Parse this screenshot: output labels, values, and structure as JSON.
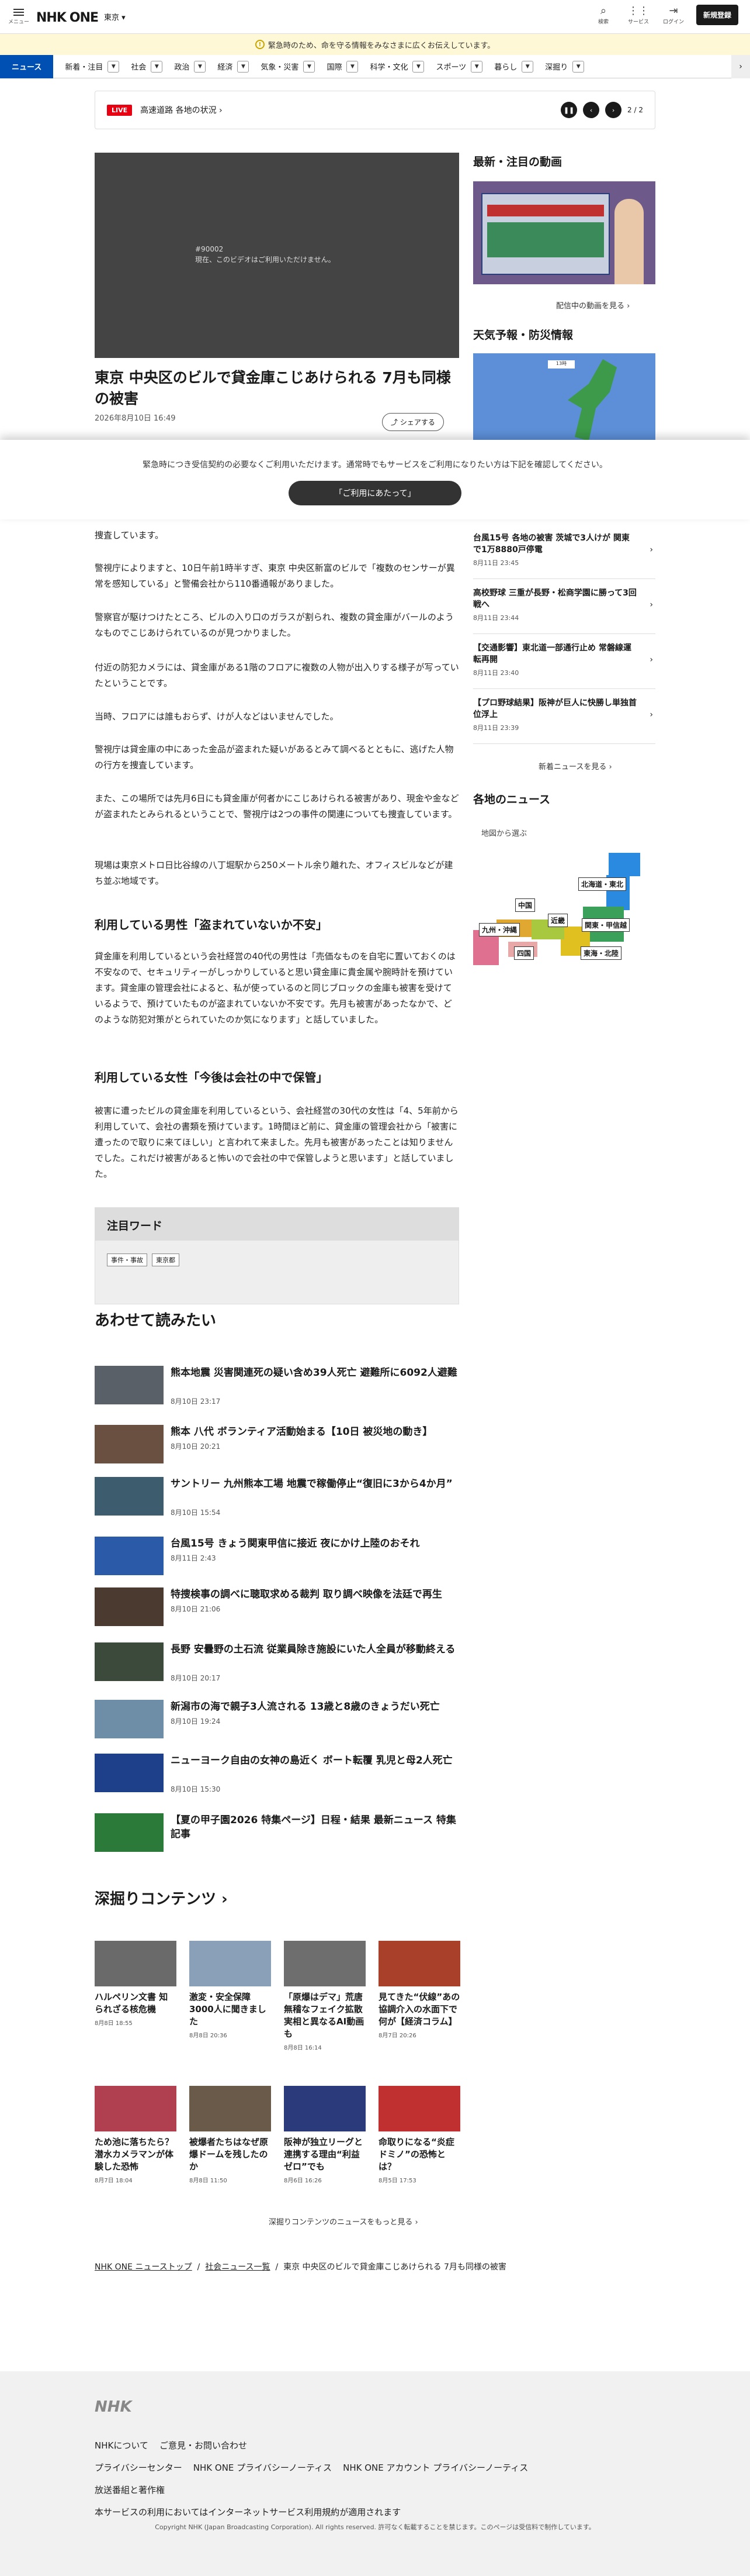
{
  "header": {
    "menu_label": "メニュー",
    "logo_text": "NHK",
    "logo_one": "ONE",
    "area": "東京 ▾",
    "icons": [
      {
        "name": "search",
        "label": "検索",
        "glyph": "⌕"
      },
      {
        "name": "service",
        "label": "サービス",
        "glyph": "⋮⋮"
      },
      {
        "name": "login",
        "label": "ログイン",
        "glyph": "⇥"
      }
    ],
    "register": "新規登録"
  },
  "alert": {
    "icon": "!",
    "text": "緊急時のため、命を守る情報をみなさまに広くお伝えしています。"
  },
  "nav": {
    "active": "ニュース",
    "items": [
      "新着・注目",
      "社会",
      "政治",
      "経済",
      "気象・災害",
      "国際",
      "科学・文化",
      "スポーツ",
      "暮らし",
      "深掘り"
    ]
  },
  "ticker": {
    "live": "LIVE",
    "text": "高速道路 各地の状況 ›",
    "pause": "❚❚",
    "prev": "‹",
    "next": "›",
    "page": "2 / 2"
  },
  "video": {
    "code": "#90002",
    "msg": "現在、このビデオはご利用いただけません。"
  },
  "article": {
    "title": "東京 中央区のビルで貸金庫こじあけられる 7月も同様の被害",
    "date": "2026年8月10日 16:49",
    "share": "シェアする",
    "p1": "捜査しています。",
    "p2": "警視庁によりますと、10日午前1時半すぎ、東京 中央区新富のビルで「複数のセンサーが異常を感知している」と警備会社から110番通報がありました。",
    "p3": "警察官が駆けつけたところ、ビルの入り口のガラスが割られ、複数の貸金庫がバールのようなものでこじあけられているのが見つかりました。",
    "p4": "付近の防犯カメラには、貸金庫がある1階のフロアに複数の人物が出入りする様子が写っていたということです。",
    "p5": "当時、フロアには誰もおらず、けが人などはいませんでした。",
    "p6": "警視庁は貸金庫の中にあった金品が盗まれた疑いがあるとみて調べるとともに、逃げた人物の行方を捜査しています。",
    "p7": "また、この場所では先月6日にも貸金庫が何者かにこじあけられる被害があり、現金や金などが盗まれたとみられるということで、警視庁は2つの事件の関連についても捜査しています。",
    "p8": "現場は東京メトロ日比谷線の八丁堀駅から250メートル余り離れた、オフィスビルなどが建ち並ぶ地域です。",
    "h1": "利用している男性「盗まれていないか不安」",
    "p9": "貸金庫を利用しているという会社経営の40代の男性は「売価なものを自宅に置いておくのは不安なので、セキュリティーがしっかりしていると思い貸金庫に貴金属や腕時計を預けています。貸金庫の管理会社によると、私が使っているのと同じブロックの金庫も被害を受けているようで、預けていたものが盗まれていないか不安です。先月も被害があったなかで、どのような防犯対策がとられていたのか気になります」と話していました。",
    "h2": "利用している女性「今後は会社の中で保管」",
    "p10": "被害に遭ったビルの貸金庫を利用しているという、会社経営の30代の女性は「4、5年前から利用していて、会社の書類を預けています。1時間ほど前に、貸金庫の管理会社から「被害に遭ったので取りに来てほしい」と言われて来ました。先月も被害があったことは知りませんでした。これだけ被害があると怖いので会社の中で保管しようと思います」と話していました。"
  },
  "overlay": {
    "text": "緊急時につき受信契約の必要なくご利用いただけます。通常時でもサービスをご利用になりたい方は下記を確認してください。",
    "button": "「ご利用にあたって」"
  },
  "watch": {
    "title": "注目ワード",
    "tags": [
      "事件・事故",
      "東京都"
    ]
  },
  "side": {
    "video_title": "最新・注目の動画",
    "video_more": "配信中の動画を見る ›",
    "weather_title": "天気予報・防災情報",
    "news": [
      {
        "t": "台風15号 各地の被害 茨城で3人けが 関東で1万8880戸停電",
        "d": "8月11日 23:45"
      },
      {
        "t": "高校野球 三重が長野・松商学園に勝って3回戦へ",
        "d": "8月11日 23:44"
      },
      {
        "t": "【交通影響】東北道一部通行止め 常磐線運転再開",
        "d": "8月11日 23:40"
      },
      {
        "t": "【プロ野球結果】阪神が巨人に快勝し単独首位浮上",
        "d": "8月11日 23:39"
      }
    ],
    "news_more": "新着ニュースを見る ›",
    "region_title": "各地のニュース",
    "region_sub": "地図から選ぶ",
    "regions": [
      "北海道・東北",
      "中国",
      "近畿",
      "関東・甲信越",
      "九州・沖縄",
      "四国",
      "東海・北陸"
    ]
  },
  "related": {
    "title": "あわせて読みたい",
    "items": [
      {
        "t": "熊本地震 災害関連死の疑い含め39人死亡 避難所に6092人避難",
        "d": "8月10日 23:17",
        "c": "#5a6068"
      },
      {
        "t": "熊本 八代 ボランティア活動始まる【10日 被災地の動き】",
        "d": "8月10日 20:21",
        "c": "#6a5040"
      },
      {
        "t": "サントリー 九州熊本工場 地震で稼働停止“復旧に3から4か月”",
        "d": "8月10日 15:54",
        "c": "#3d5d6e"
      },
      {
        "t": "台風15号 きょう関東甲信に接近 夜にかけ上陸のおそれ",
        "d": "8月11日 2:43",
        "c": "#2a5aa8"
      },
      {
        "t": "特捜検事の調べに聴取求める裁判 取り調べ映像を法廷で再生",
        "d": "8月10日 21:06",
        "c": "#4a3a30"
      },
      {
        "t": "長野 安曇野の土石流 従業員除き施設にいた人全員が移動終える",
        "d": "8月10日 20:17",
        "c": "#3b4a3a"
      },
      {
        "t": "新潟市の海で親子3人流される 13歳と8歳のきょうだい死亡",
        "d": "8月10日 19:24",
        "c": "#6e8ea8"
      },
      {
        "t": "ニューヨーク自由の女神の島近く ボート転覆 乳児と母2人死亡",
        "d": "8月10日 15:30",
        "c": "#1e3f8a"
      },
      {
        "t": "【夏の甲子園2026 特集ページ】日程・結果 最新ニュース 特集記事",
        "d": "",
        "c": "#2c7a3a"
      }
    ]
  },
  "deep": {
    "title": "深掘りコンテンツ ›",
    "more": "深掘りコンテンツのニュースをもっと見る ›",
    "items": [
      {
        "t": "ハルペリン文書 知られざる核危機",
        "d": "8月8日 18:55",
        "c": "#6a6a6a"
      },
      {
        "t": "激変・安全保障 3000人に聞きました",
        "d": "8月8日 20:36",
        "c": "#8aa0b8"
      },
      {
        "t": "「原爆はデマ」荒唐無稽なフェイク拡散 実相と異なるAI動画も",
        "d": "8月8日 16:14",
        "c": "#6e6e6e"
      },
      {
        "t": "見てきた“伏線”あの協調介入の水面下で何が【経済コラム】",
        "d": "8月7日 20:26",
        "c": "#a8402a"
      },
      {
        "t": "ため池に落ちたら？ 潜水カメラマンが体験した恐怖",
        "d": "8月7日 18:04",
        "c": "#b04050"
      },
      {
        "t": "被爆者たちはなぜ原爆ドームを残したのか",
        "d": "8月8日 11:50",
        "c": "#6a5a4a"
      },
      {
        "t": "阪神が独立リーグと連携する理由“利益ゼロ”でも",
        "d": "8月6日 16:26",
        "c": "#2a3a7a"
      },
      {
        "t": "命取りになる“炎症ドミノ”の恐怖とは？",
        "d": "8月5日 17:53",
        "c": "#c03030"
      }
    ]
  },
  "breadcrumb": [
    "NHK ONE ニューストップ",
    "社会ニュース一覧",
    "東京 中央区のビルで貸金庫こじあけられる 7月も同様の被害"
  ],
  "footer": {
    "logo": "NHK",
    "links1": [
      "NHKについて",
      "ご意見・お問い合わせ"
    ],
    "links2": [
      "プライバシーセンター",
      "NHK ONE プライバシーノーティス",
      "NHK ONE アカウント プライバシーノーティス"
    ],
    "link3": "放送番組と著作権",
    "link4": "本サービスの利用においてはインターネットサービス利用規約が適用されます",
    "copy": "Copyright NHK (Japan Broadcasting Corporation). All rights reserved. 許可なく転載することを禁じます。このページは受信料で制作しています。"
  }
}
